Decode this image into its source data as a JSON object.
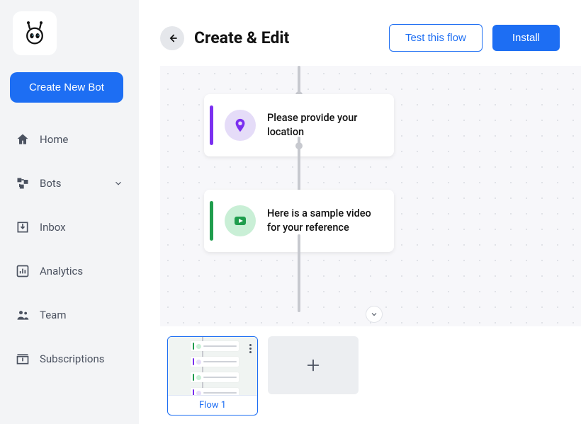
{
  "sidebar": {
    "create_label": "Create New Bot",
    "items": [
      {
        "label": "Home"
      },
      {
        "label": "Bots"
      },
      {
        "label": "Inbox"
      },
      {
        "label": "Analytics"
      },
      {
        "label": "Team"
      },
      {
        "label": "Subscriptions"
      }
    ]
  },
  "header": {
    "title": "Create & Edit",
    "test_label": "Test this flow",
    "install_label": "Install"
  },
  "canvas": {
    "cards": [
      {
        "text": "Please provide your location",
        "accent": "#7b2ff0",
        "icon_bg": "#e5dcf8",
        "icon_fg": "#7b2ff0"
      },
      {
        "text": "Here is a sample video for your reference",
        "accent": "#1f9d4d",
        "icon_bg": "#c9efd6",
        "icon_fg": "#1f9d4d"
      }
    ]
  },
  "strip": {
    "active_thumb": "Flow 1"
  }
}
